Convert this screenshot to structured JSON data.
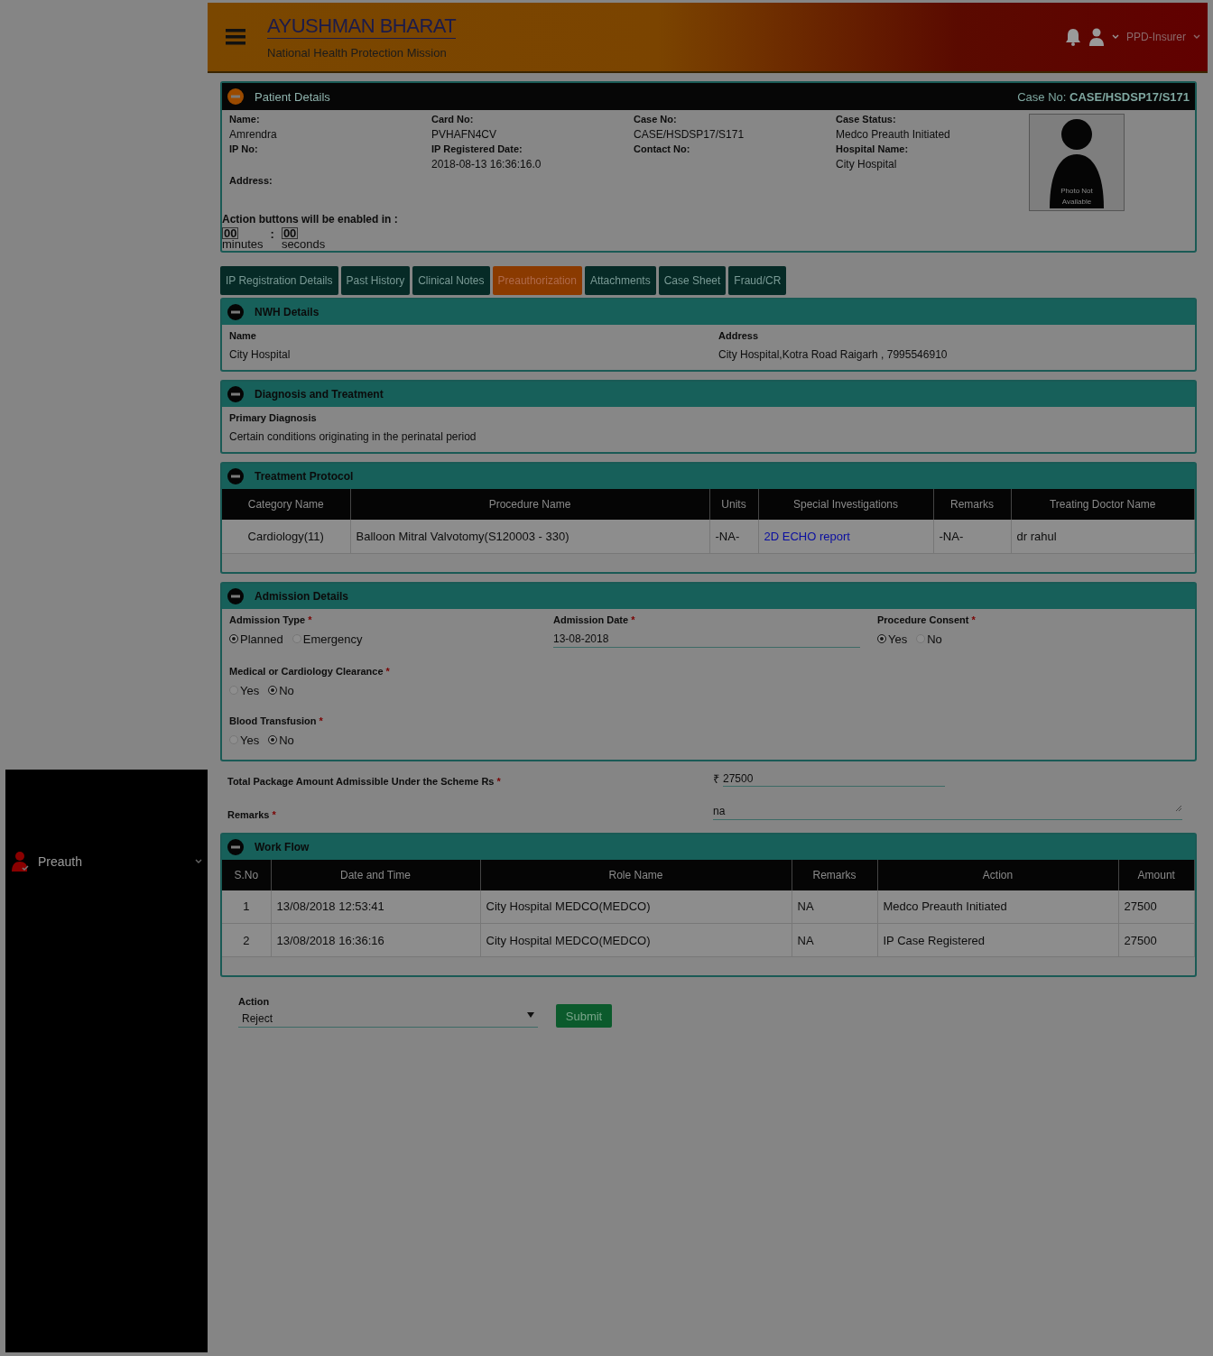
{
  "header": {
    "title": "AYUSHMAN BHARAT",
    "subtitle": "National Health Protection Mission",
    "user": "PPD-Insurer"
  },
  "sidebar": {
    "items": [
      {
        "label": "Preauth"
      }
    ]
  },
  "patient_details": {
    "title": "Patient Details",
    "case_no": "Case No: **CASE/HSDSP17/S171**",
    "columns": [
      [
        {
          "label": "Name:",
          "value": "Amrendra"
        },
        {
          "label": "IP No:"
        },
        {
          "label": "Address:"
        }
      ],
      [
        {
          "label": "Card No:",
          "value": "PVHAFN4CV"
        },
        {
          "label": "IP Registered Date:",
          "value": "2018-08-13 16:36:16.0"
        }
      ],
      [
        {
          "label": "Case No:",
          "value": "CASE/HSDSP17/S171"
        },
        {
          "label": "Contact No:"
        }
      ],
      [
        {
          "label": "Case Status:",
          "value": "Medco Preauth Initiated"
        },
        {
          "label": "Hospital Name:",
          "value": "City Hospital"
        }
      ]
    ],
    "photo_text": "Photo Not Available",
    "timer": {
      "label": "Action buttons will be enabled in :",
      "minutes": "00",
      "minutes_label": "minutes",
      "separator": ":",
      "seconds": "00",
      "seconds_label": "seconds"
    }
  },
  "tabs": [
    {
      "label": "IP Registration Details",
      "selected": false
    },
    {
      "label": "Past History",
      "selected": false
    },
    {
      "label": "Clinical Notes",
      "selected": false
    },
    {
      "label": "Preauthorization",
      "selected": true
    },
    {
      "label": "Attachments",
      "selected": false
    },
    {
      "label": "Case Sheet",
      "selected": false
    },
    {
      "label": "Fraud/CR",
      "selected": false
    }
  ],
  "nwh_details": {
    "title": "NWH Details",
    "fields": [
      {
        "label": "Name",
        "value": "City Hospital"
      },
      {
        "label": "Address",
        "value": "City Hospital,Kotra Road Raigarh , 7995546910"
      }
    ]
  },
  "diagnosis": {
    "title": "Diagnosis and Treatment",
    "label": "Primary Diagnosis",
    "value": "Certain conditions originating in the perinatal period"
  },
  "treatment_protocol": {
    "title": "Treatment Protocol",
    "columns": [
      "Category Name",
      "Procedure Name",
      "Units",
      "Special Investigations",
      "Remarks",
      "Treating Doctor Name"
    ],
    "rows": [
      {
        "category": "Cardiology(11)",
        "procedure": "Balloon Mitral Valvotomy(S120003 - 330)",
        "units": "-NA-",
        "investigations": "2D ECHO report",
        "remarks": "-NA-",
        "doctor": "dr rahul"
      }
    ]
  },
  "admission_details": {
    "title": "Admission Details",
    "rows": [
      [
        {
          "kind": "radio",
          "label": "Admission Type",
          "marker": "*",
          "options": [
            {
              "label": "Planned",
              "selected": true
            },
            {
              "label": "Emergency",
              "selected": false
            }
          ]
        },
        {
          "kind": "date",
          "label": "Admission Date",
          "marker": "*",
          "value": "13-08-2018"
        },
        {
          "kind": "radio",
          "label": "Procedure Consent",
          "marker": "*",
          "options": [
            {
              "label": "Yes",
              "selected": true
            },
            {
              "label": "No",
              "selected": false
            }
          ]
        }
      ],
      [
        {
          "kind": "radio",
          "label": "Medical or Cardiology Clearance",
          "marker": "*",
          "options": [
            {
              "label": "Yes",
              "selected": false
            },
            {
              "label": "No",
              "selected": true
            }
          ]
        }
      ],
      [
        {
          "kind": "radio",
          "label": "Blood Transfusion",
          "marker": "*",
          "options": [
            {
              "label": "Yes",
              "selected": false
            },
            {
              "label": "No",
              "selected": true
            }
          ]
        }
      ]
    ]
  },
  "package_amount": {
    "label": "Total Package Amount Admissible Under the Scheme Rs",
    "marker": "*",
    "currency": "₹",
    "value": "27500"
  },
  "remarks": {
    "label": "Remarks",
    "marker": "*",
    "value": "na"
  },
  "work_flow": {
    "title": "Work Flow",
    "columns": [
      "S.No",
      "Date and Time",
      "Role Name",
      "Remarks",
      "Action",
      "Amount"
    ],
    "rows": [
      [
        "1",
        "13/08/2018 12:53:41",
        "City Hospital MEDCO(MEDCO)",
        "NA",
        "Medco Preauth Initiated",
        "27500"
      ],
      [
        "2",
        "13/08/2018 16:36:16",
        "City Hospital MEDCO(MEDCO)",
        "NA",
        "IP Case Registered",
        "27500"
      ]
    ]
  },
  "action": {
    "label": "Action",
    "value": "Reject",
    "button": "Submit"
  }
}
